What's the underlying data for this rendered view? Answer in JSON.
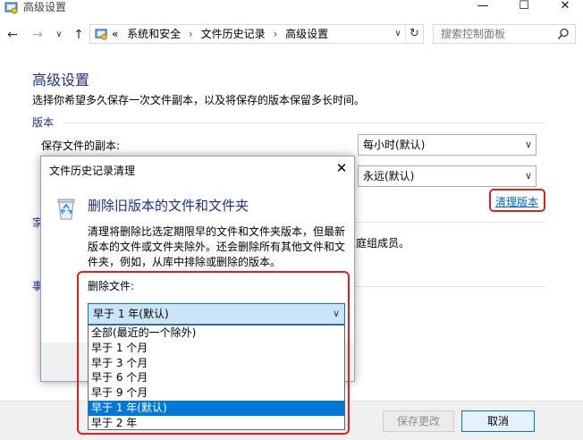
{
  "window": {
    "title": "高级设置",
    "minimize_glyph": "—",
    "maximize_glyph": "☐",
    "close_glyph": "✕"
  },
  "nav": {
    "back_glyph": "←",
    "forward_glyph": "→",
    "dropdown_glyph": "∨",
    "up_glyph": "↑"
  },
  "address": {
    "prefix": "«",
    "crumbs": [
      "系统和安全",
      "文件历史记录",
      "高级设置"
    ],
    "separator": "›",
    "dropdown_glyph": "∨",
    "refresh_glyph": "↻"
  },
  "search": {
    "placeholder": "搜索控制面板"
  },
  "main": {
    "title": "高级设置",
    "description": "选择你希望多久保存一次文件副本，以及将保存的版本保留多长时间。",
    "versions_section": "版本",
    "save_copies_label": "保存文件的副本:",
    "save_frequency": "每小时(默认)",
    "keep_versions": "永远(默认)",
    "cleanup_link": "清理版本",
    "homegroup_tail": "庭组成员。",
    "edge_glyph_1": "家",
    "edge_glyph_2": "事"
  },
  "footer": {
    "save_button": "保存更改",
    "cancel_button": "取消"
  },
  "dialog": {
    "title": "文件历史记录清理",
    "heading": "删除旧版本的文件和文件夹",
    "body": "清理将删除比选定期限早的文件和文件夹版本，但最新版本的文件或文件夹除外。还会删除所有其他文件和文件夹，例如，从库中排除或删除的版本。",
    "delete_label": "删除文件:",
    "selected": "早于 1 年(默认)",
    "options": [
      "全部(最近的一个除外)",
      "早于 1 个月",
      "早于 3 个月",
      "早于 6 个月",
      "早于 9 个月",
      "早于 1 年(默认)",
      "早于 2 年"
    ],
    "highlighted_index": 5
  },
  "colors": {
    "heading_blue": "#1e3287",
    "link_blue": "#0066cc",
    "highlight_red": "#e02020",
    "selection_blue": "#0078d7"
  }
}
